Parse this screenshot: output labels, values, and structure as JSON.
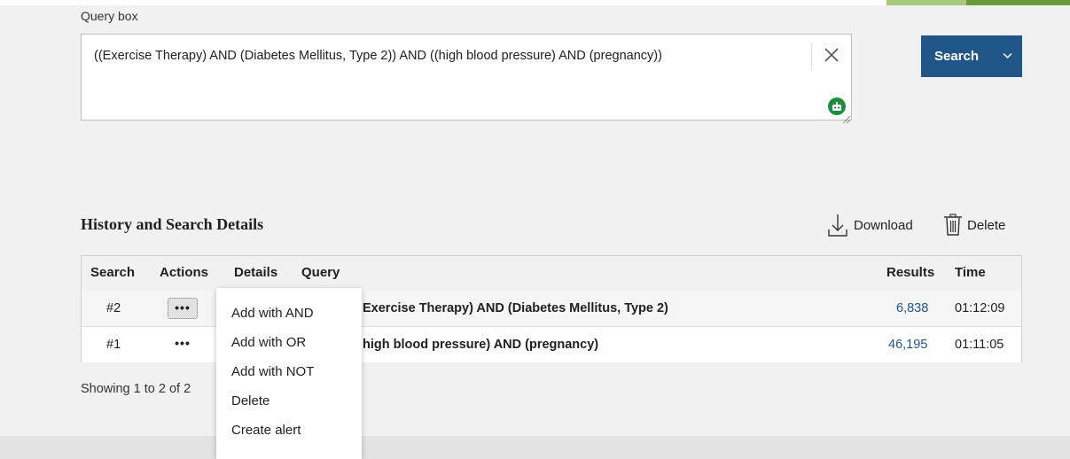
{
  "query_box": {
    "label": "Query box",
    "value": "((Exercise Therapy) AND (Diabetes Mellitus, Type 2)) AND ((high blood pressure) AND (pregnancy))"
  },
  "search_button": {
    "label": "Search"
  },
  "history": {
    "title": "History and Search Details",
    "download_label": "Download",
    "delete_label": "Delete",
    "columns": {
      "search": "Search",
      "actions": "Actions",
      "details": "Details",
      "query": "Query",
      "results": "Results",
      "time": "Time"
    },
    "rows": [
      {
        "search": "#2",
        "actions": "•••",
        "query": "Exercise Therapy) AND (Diabetes Mellitus, Type 2)",
        "results": "6,838",
        "time": "01:12:09"
      },
      {
        "search": "#1",
        "actions": "•••",
        "query": "high blood pressure) AND (pregnancy)",
        "results": "46,195",
        "time": "01:11:05"
      }
    ],
    "showing": "Showing 1 to 2 of 2"
  },
  "actions_menu": {
    "items": [
      "Add with AND",
      "Add with OR",
      "Add with NOT",
      "Delete",
      "Create alert"
    ]
  },
  "colors": {
    "primary": "#20558a",
    "robot": "#1e8e3e"
  }
}
